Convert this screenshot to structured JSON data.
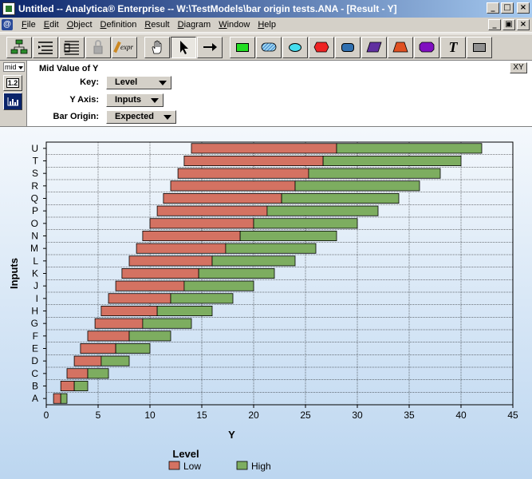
{
  "window": {
    "title": "Untitled -- Analytica® Enterprise -- W:\\TestModels\\bar origin tests.ANA - [Result - Y]",
    "min": "_",
    "max": "□",
    "close": "×",
    "doc_min": "_",
    "doc_restore": "▣",
    "doc_close": "×"
  },
  "menu": [
    "File",
    "Edit",
    "Object",
    "Definition",
    "Result",
    "Diagram",
    "Window",
    "Help"
  ],
  "toolbar": {
    "expr_label": "expr",
    "text_tool": "T"
  },
  "side": {
    "mid_select": "mid",
    "table_button": "1.2"
  },
  "controls": {
    "title": "Mid Value of Y",
    "key_label": "Key:",
    "key_value": "Level",
    "yaxis_label": "Y Axis:",
    "yaxis_value": "Inputs",
    "origin_label": "Bar Origin:",
    "origin_value": "Expected",
    "xy_button": "XY"
  },
  "colors": {
    "low": "#d47262",
    "high": "#7dad60"
  },
  "chart_data": {
    "type": "bar",
    "orientation": "horizontal",
    "stacked": true,
    "categories": [
      "A",
      "B",
      "C",
      "D",
      "E",
      "F",
      "G",
      "H",
      "I",
      "J",
      "K",
      "L",
      "M",
      "N",
      "O",
      "P",
      "Q",
      "R",
      "S",
      "T",
      "U"
    ],
    "series": [
      {
        "name": "Low",
        "start": [
          0.7,
          1.4,
          2.0,
          2.7,
          3.3,
          4.0,
          4.7,
          5.3,
          6.0,
          6.7,
          7.3,
          8.0,
          8.7,
          9.3,
          10.0,
          10.7,
          11.3,
          12.0,
          12.7,
          13.3,
          14.0
        ],
        "end": [
          1.4,
          2.7,
          4.0,
          5.3,
          6.7,
          8.0,
          9.3,
          10.7,
          12.0,
          13.3,
          14.7,
          16.0,
          17.3,
          18.7,
          20.0,
          21.3,
          22.7,
          24.0,
          25.3,
          26.7,
          28.0
        ]
      },
      {
        "name": "High",
        "start": [
          1.4,
          2.7,
          4.0,
          5.3,
          6.7,
          8.0,
          9.3,
          10.7,
          12.0,
          13.3,
          14.7,
          16.0,
          17.3,
          18.7,
          20.0,
          21.3,
          22.7,
          24.0,
          25.3,
          26.7,
          28.0
        ],
        "end": [
          2.0,
          4.0,
          6.0,
          8.0,
          10.0,
          12.0,
          14.0,
          16.0,
          18.0,
          20.0,
          22.0,
          24.0,
          26.0,
          28.0,
          30.0,
          32.0,
          34.0,
          36.0,
          38.0,
          40.0,
          42.0
        ]
      }
    ],
    "xlabel": "Y",
    "ylabel": "Inputs",
    "xlim": [
      0,
      45
    ],
    "xticks": [
      "0",
      "5",
      "10",
      "15",
      "20",
      "25",
      "30",
      "35",
      "40",
      "45"
    ],
    "grid": true,
    "legend": {
      "title": "Level",
      "entries": [
        "Low",
        "High"
      ],
      "placement": "bottom-center"
    }
  }
}
